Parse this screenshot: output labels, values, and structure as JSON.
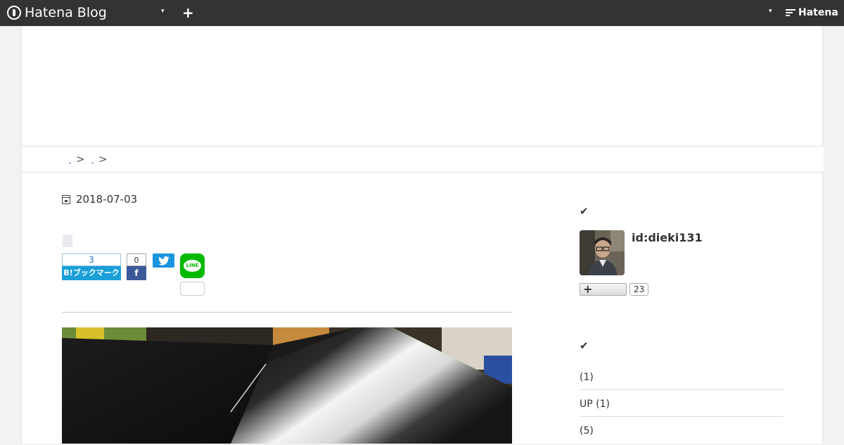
{
  "topbar": {
    "logo_text": "Hatena Blog",
    "dropdown_arrow": "▾",
    "add_icon": "+",
    "brand_text": "Hatena"
  },
  "breadcrumb": {
    "separators": [
      ">",
      ">"
    ]
  },
  "entry": {
    "date": "2018-07-03",
    "share": {
      "hatena_bookmark_count": "3",
      "hatena_bookmark_label": "B!ブックマーク",
      "facebook_count": "0",
      "facebook_icon": "f",
      "line_label": "LINE"
    }
  },
  "sidebar": {
    "profile_heading_icon": "✔",
    "user_id": "id:dieki131",
    "subscribe_icon": "+",
    "subscriber_count": "23",
    "categories_heading_icon": "✔",
    "categories": [
      {
        "label": " (1)"
      },
      {
        "label": "UP (1)"
      },
      {
        "label": " (5)"
      }
    ]
  },
  "colors": {
    "topbar_bg": "#333333",
    "hatena_bookmark": "#1a9fd8",
    "facebook": "#3b5998",
    "twitter": "#1b95e0",
    "line": "#00b900"
  },
  "icons": [
    "hatena-blog-logo-icon",
    "chevron-down-icon",
    "plus-icon",
    "hatena-logo-icon",
    "calendar-icon",
    "twitter-bird-icon",
    "facebook-icon",
    "line-icon",
    "check-icon"
  ]
}
